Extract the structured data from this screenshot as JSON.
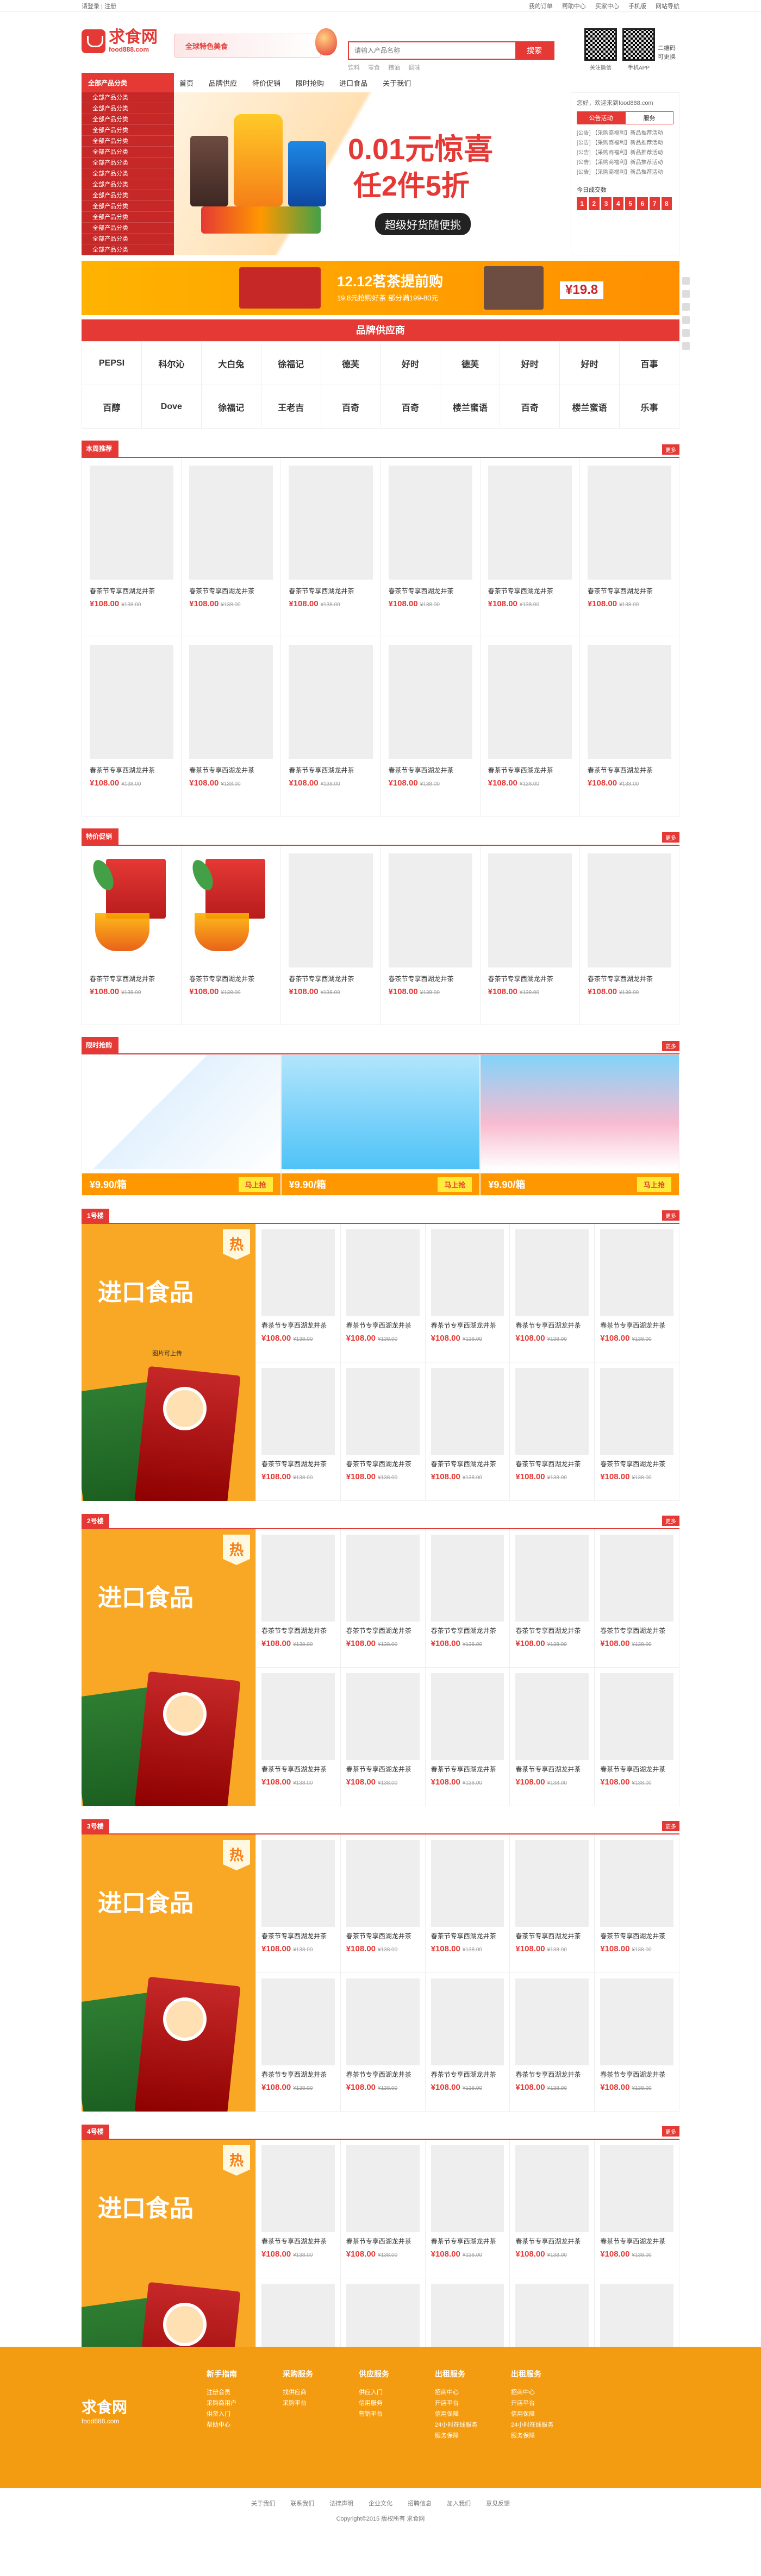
{
  "topbar": {
    "left": "请登录 | 注册",
    "right": [
      "我的订单",
      "帮助中心",
      "买家中心",
      "手机版",
      "网站导航"
    ]
  },
  "logo": {
    "name": "求食网",
    "domain": "food888.com"
  },
  "banner_ad": {
    "text": "全球特色美食"
  },
  "search": {
    "placeholder": "请输入产品名称",
    "button": "搜索",
    "hotwords": [
      "饮料",
      "零食",
      "粮油",
      "调味"
    ]
  },
  "qr": [
    {
      "label": "关注微信"
    },
    {
      "label": "手机APP"
    }
  ],
  "qr_note": "二维码可更换",
  "nav": {
    "category_head": "全部产品分类",
    "items": [
      "首页",
      "品牌供应",
      "特价促销",
      "限时抢购",
      "进口食品",
      "关于我们"
    ]
  },
  "categories": [
    "全部产品分类",
    "全部产品分类",
    "全部产品分类",
    "全部产品分类",
    "全部产品分类",
    "全部产品分类",
    "全部产品分类",
    "全部产品分类",
    "全部产品分类",
    "全部产品分类",
    "全部产品分类",
    "全部产品分类",
    "全部产品分类",
    "全部产品分类",
    "全部产品分类"
  ],
  "hero": {
    "line1": "0.01元惊喜",
    "line2": "任2件5折",
    "line3": "超级好货随便挑"
  },
  "news": {
    "welcome": "您好，欢迎来到food888.com",
    "tabs": [
      "公告活动",
      "服务"
    ],
    "rows": [
      "[公告] 【采购商福利】新品推荐活动",
      "[公告] 【采购商福利】新品推荐活动",
      "[公告] 【采购商福利】新品推荐活动",
      "[公告] 【采购商福利】新品推荐活动",
      "[公告] 【采购商福利】新品推荐活动"
    ],
    "deal_label": "今日成交数",
    "digits": [
      "1",
      "2",
      "3",
      "4",
      "5",
      "6",
      "7",
      "8"
    ]
  },
  "adbar": {
    "title": "12.12茗茶提前购",
    "sub": "19.8元抢购好茶 部分满199-80元",
    "price": "¥19.8"
  },
  "brands": {
    "title": "品牌供应商",
    "items": [
      "PEPSI",
      "科尔沁",
      "大白兔",
      "徐福记",
      "德芙",
      "好时",
      "德芙",
      "好时",
      "好时",
      "百事",
      "百醇",
      "Dove",
      "徐福记",
      "王老吉",
      "百奇",
      "百奇",
      "楼兰蜜语",
      "百奇",
      "楼兰蜜语",
      "乐事"
    ]
  },
  "floor_recommend": {
    "tag": "本周推荐",
    "more": "更多"
  },
  "product_template": {
    "name": "春茶节专享西湖龙井茶",
    "price": "¥108.00",
    "old_price": "¥138.00"
  },
  "floor_special": {
    "tag": "特价促销",
    "more": "更多"
  },
  "floor_flash": {
    "tag": "限时抢购",
    "more": "更多",
    "items": [
      {
        "price": "¥9.90/箱",
        "btn": "马上抢"
      },
      {
        "price": "¥9.90/箱",
        "btn": "马上抢"
      },
      {
        "price": "¥9.90/箱",
        "btn": "马上抢"
      }
    ]
  },
  "floors": [
    {
      "no": "1号楼",
      "title": "进口食品",
      "hot": "热",
      "note": "图片可上传",
      "more": "更多"
    },
    {
      "no": "2号楼",
      "title": "进口食品",
      "hot": "热",
      "note": "",
      "more": "更多"
    },
    {
      "no": "3号楼",
      "title": "进口食品",
      "hot": "热",
      "note": "",
      "more": "更多"
    },
    {
      "no": "4号楼",
      "title": "进口食品",
      "hot": "热",
      "note": "",
      "more": "更多"
    }
  ],
  "footer": {
    "cols": [
      {
        "h": "新手指南",
        "items": [
          "注册会员",
          "采购商用户",
          "供货入门",
          "帮助中心"
        ]
      },
      {
        "h": "采购服务",
        "items": [
          "找供应商",
          "采购平台"
        ]
      },
      {
        "h": "供应服务",
        "items": [
          "供应入门",
          "信用服务",
          "营销平台"
        ]
      },
      {
        "h": "出租服务",
        "items": [
          "招商中心",
          "开店平台",
          "信用保障",
          "24小时在线服务",
          "服务保障"
        ]
      },
      {
        "h": "出租服务",
        "items": [
          "招商中心",
          "开店平台",
          "信用保障",
          "24小时在线服务",
          "服务保障"
        ]
      }
    ]
  },
  "copyright": {
    "links": [
      "关于我们",
      "联系我们",
      "法律声明",
      "企业文化",
      "招聘信息",
      "加入我们",
      "意见反馈"
    ],
    "line": "Copyright©2015  版权所有 求食网"
  }
}
